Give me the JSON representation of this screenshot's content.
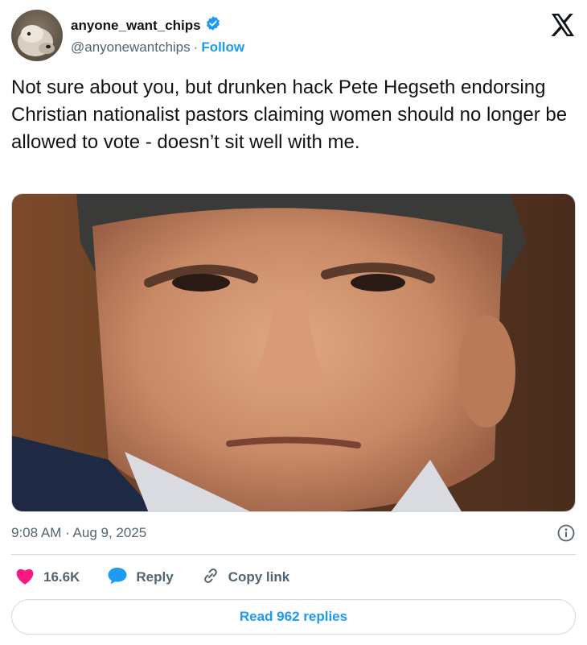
{
  "author": {
    "display_name": "anyone_want_chips",
    "handle": "@anyonewantchips",
    "separator": "·",
    "follow_label": "Follow",
    "avatar_icon": "dog-avatar",
    "verified_icon": "verified-badge-icon"
  },
  "platform_logo": "x-logo",
  "tweet": {
    "text": "Not sure about you, but drunken hack Pete Hegseth endorsing Christian nationalist pastors claiming women should no longer be allowed to vote - doesn’t sit well with me.",
    "timestamp": "9:08 AM · Aug 9, 2025",
    "media_icon": "photo-man-close-up"
  },
  "actions": {
    "likes_count": "16.6K",
    "reply_label": "Reply",
    "copy_link_label": "Copy link"
  },
  "read_replies_label": "Read 962 replies",
  "colors": {
    "accent": "#1d9bf0",
    "like": "#f91880",
    "text": "#0f1419",
    "muted": "#536471",
    "border": "#cfd9de"
  }
}
